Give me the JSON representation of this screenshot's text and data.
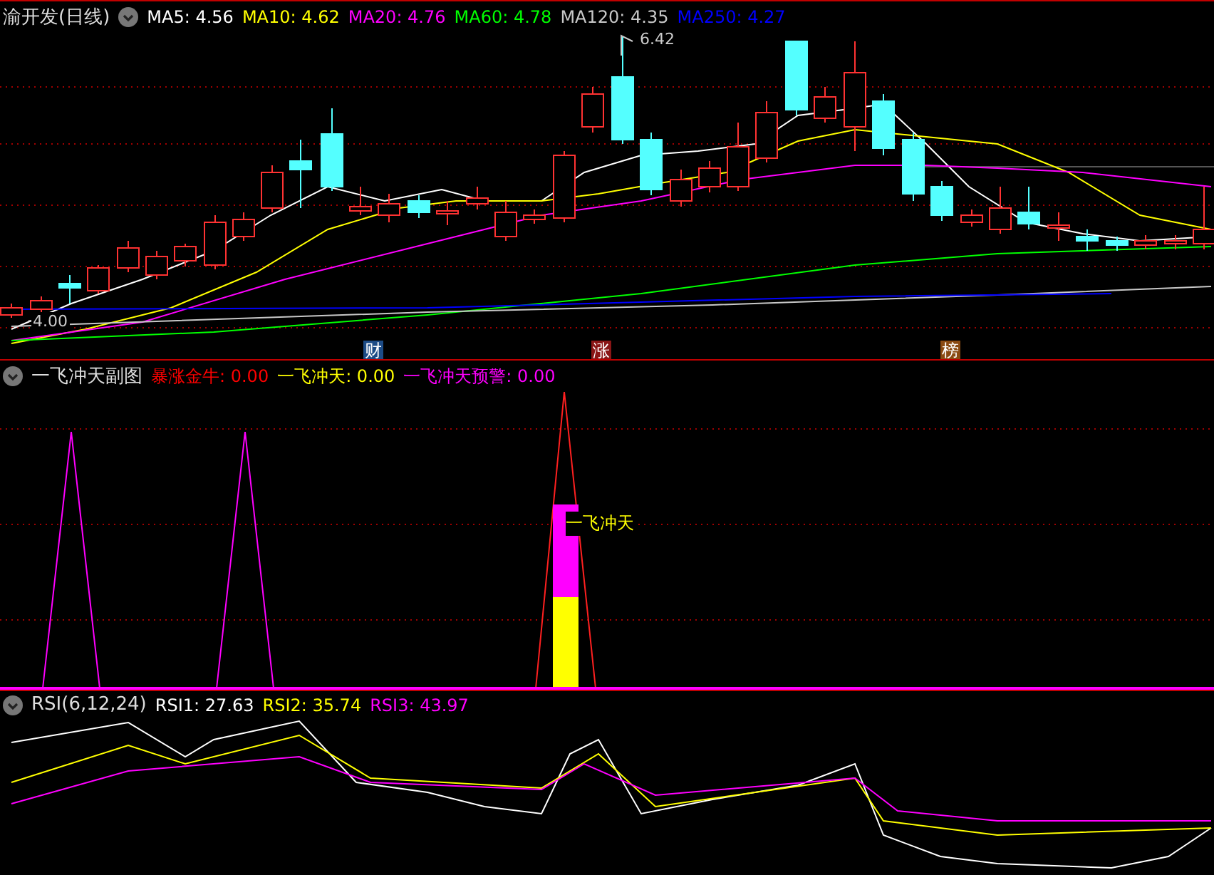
{
  "main_panel": {
    "title": "渝开发(日线)",
    "indicators": [
      {
        "label": "MA5:",
        "value": "4.56",
        "color": "#ffffff"
      },
      {
        "label": "MA10:",
        "value": "4.62",
        "color": "#ffff00"
      },
      {
        "label": "MA20:",
        "value": "4.76",
        "color": "#ff00ff"
      },
      {
        "label": "MA60:",
        "value": "4.78",
        "color": "#00ff00"
      },
      {
        "label": "MA120:",
        "value": "4.35",
        "color": "#c8c8c8"
      },
      {
        "label": "MA250:",
        "value": "4.27",
        "color": "#0000ff"
      }
    ],
    "high_label": "6.42",
    "low_label": "4.00",
    "markers": [
      {
        "text": "财",
        "color": "#1c4b86"
      },
      {
        "text": "涨",
        "color": "#8a1616"
      },
      {
        "text": "榜",
        "color": "#8a4a12"
      }
    ]
  },
  "sub_panel": {
    "title": "一飞冲天副图",
    "indicators": [
      {
        "label": "暴涨金牛:",
        "value": "0.00",
        "color": "#ff0000"
      },
      {
        "label": "一飞冲天:",
        "value": "0.00",
        "color": "#ffff00"
      },
      {
        "label": "一飞冲天预警:",
        "value": "0.00",
        "color": "#ff00ff"
      }
    ],
    "signal_label": "一飞冲天"
  },
  "rsi_panel": {
    "title": "RSI(6,12,24)",
    "indicators": [
      {
        "label": "RSI1:",
        "value": "27.63",
        "color": "#ffffff"
      },
      {
        "label": "RSI2:",
        "value": "35.74",
        "color": "#ffff00"
      },
      {
        "label": "RSI3:",
        "value": "43.97",
        "color": "#ff00ff"
      }
    ]
  }
}
